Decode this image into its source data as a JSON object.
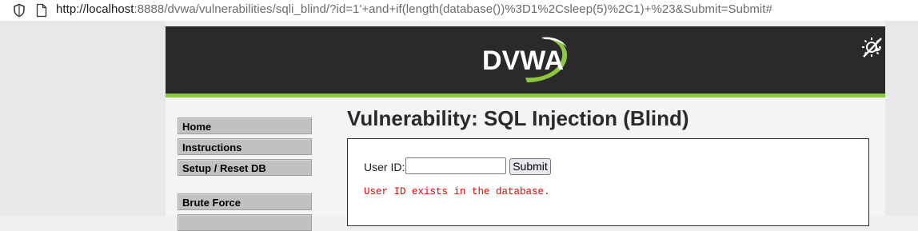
{
  "browser": {
    "url_host": "http://localhost",
    "url_rest": ":8888/dvwa/vulnerabilities/sqli_blind/?id=1'+and+if(length(database())%3D1%2Csleep(5)%2C1)+%23&Submit=Submit#",
    "icons": [
      "shield-icon",
      "page-icon"
    ]
  },
  "header": {
    "logo_text": "DVWA",
    "accent_color": "#8dc63f",
    "header_bg": "#2a2a2a",
    "theme_icon": "theme-toggle-icon"
  },
  "menu": {
    "items": [
      {
        "label": "Home"
      },
      {
        "label": "Instructions"
      },
      {
        "label": "Setup / Reset DB"
      },
      {
        "label": "Brute Force"
      }
    ]
  },
  "main": {
    "title": "Vulnerability: SQL Injection (Blind)",
    "form": {
      "userid_label": "User ID:",
      "userid_value": "",
      "submit_label": "Submit"
    },
    "result_message": "User ID exists in the database.",
    "result_color": "#e00000"
  }
}
